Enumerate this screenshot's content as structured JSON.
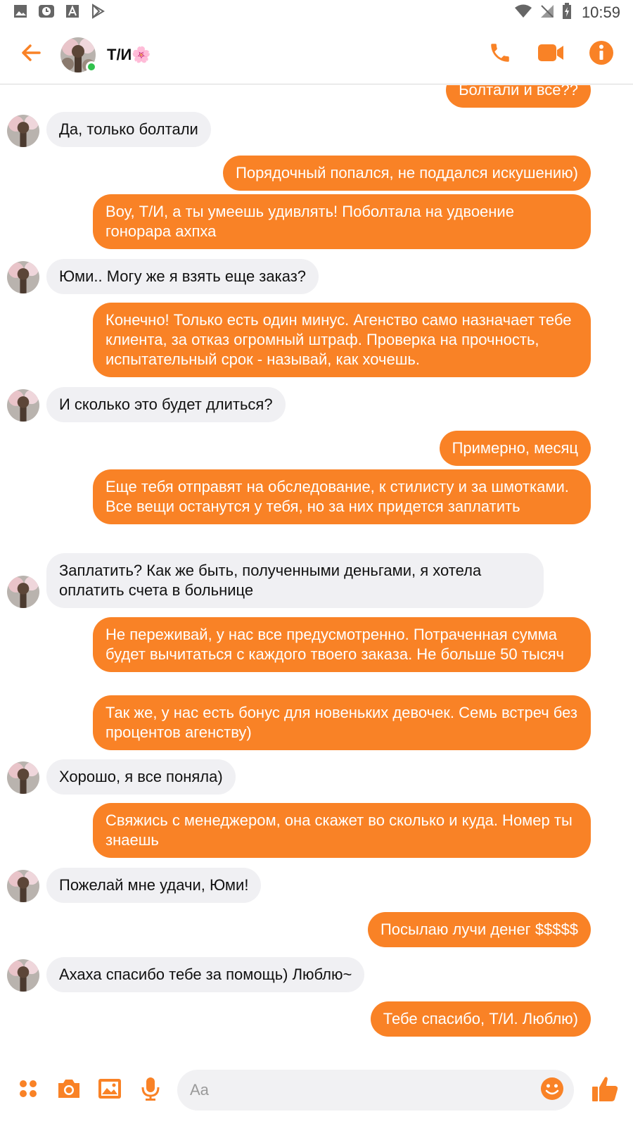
{
  "status_bar": {
    "time": "10:59"
  },
  "header": {
    "contact_name": "Т/И🌸"
  },
  "messages": [
    {
      "dir": "out",
      "text": "Болтали и все??"
    },
    {
      "dir": "in",
      "text": "Да, только болтали"
    },
    {
      "dir": "out",
      "text": "Порядочный попался, не поддался искушению)"
    },
    {
      "dir": "out",
      "text": "Воу, Т/И, а ты умеешь удивлять! Поболтала на удвоение гонорара ахпха"
    },
    {
      "dir": "in",
      "text": "Юми.. Могу же я взять еще заказ?"
    },
    {
      "dir": "out",
      "text": "Конечно! Только есть один минус. Агенство само назначает тебе клиента, за отказ огромный штраф. Проверка на прочность, испытательный срок - называй, как хочешь."
    },
    {
      "dir": "in",
      "text": "И сколько это будет длиться?"
    },
    {
      "dir": "out",
      "text": "Примерно, месяц"
    },
    {
      "dir": "out",
      "text": "Еще тебя отправят на обследование, к стилисту и за шмотками. Все вещи останутся у тебя, но за них придется заплатить"
    },
    {
      "dir": "in",
      "text": "Заплатить? Как же быть, полученными деньгами, я хотела оплатить счета в больнице"
    },
    {
      "dir": "out",
      "text": "Не переживай, у нас все предусмотренно. Потраченная сумма будет вычитаться с каждого твоего заказа. Не больше 50 тысяч"
    },
    {
      "dir": "out",
      "text": "Так же, у нас есть бонус для новеньких девочек. Семь встреч без процентов агенству)"
    },
    {
      "dir": "in",
      "text": "Хорошо, я все поняла)"
    },
    {
      "dir": "out",
      "text": "Свяжись с менеджером, она скажет во сколько и куда. Номер ты знаешь"
    },
    {
      "dir": "in",
      "text": "Пожелай мне удачи, Юми!"
    },
    {
      "dir": "out",
      "text": "Посылаю лучи денег $$$$$"
    },
    {
      "dir": "in",
      "text": "Ахаха спасибо тебе за помощь) Люблю~"
    },
    {
      "dir": "out",
      "text": "Тебе спасибо, Т/И. Люблю)"
    }
  ],
  "composer": {
    "placeholder": "Aa"
  },
  "colors": {
    "accent": "#f98226",
    "incoming_bubble": "#f0f0f3",
    "online": "#31c24d"
  },
  "icons": [
    "back-arrow-icon",
    "phone-icon",
    "video-camera-icon",
    "info-icon",
    "apps-icon",
    "camera-icon",
    "gallery-icon",
    "microphone-icon",
    "emoji-icon",
    "thumbs-up-icon"
  ]
}
